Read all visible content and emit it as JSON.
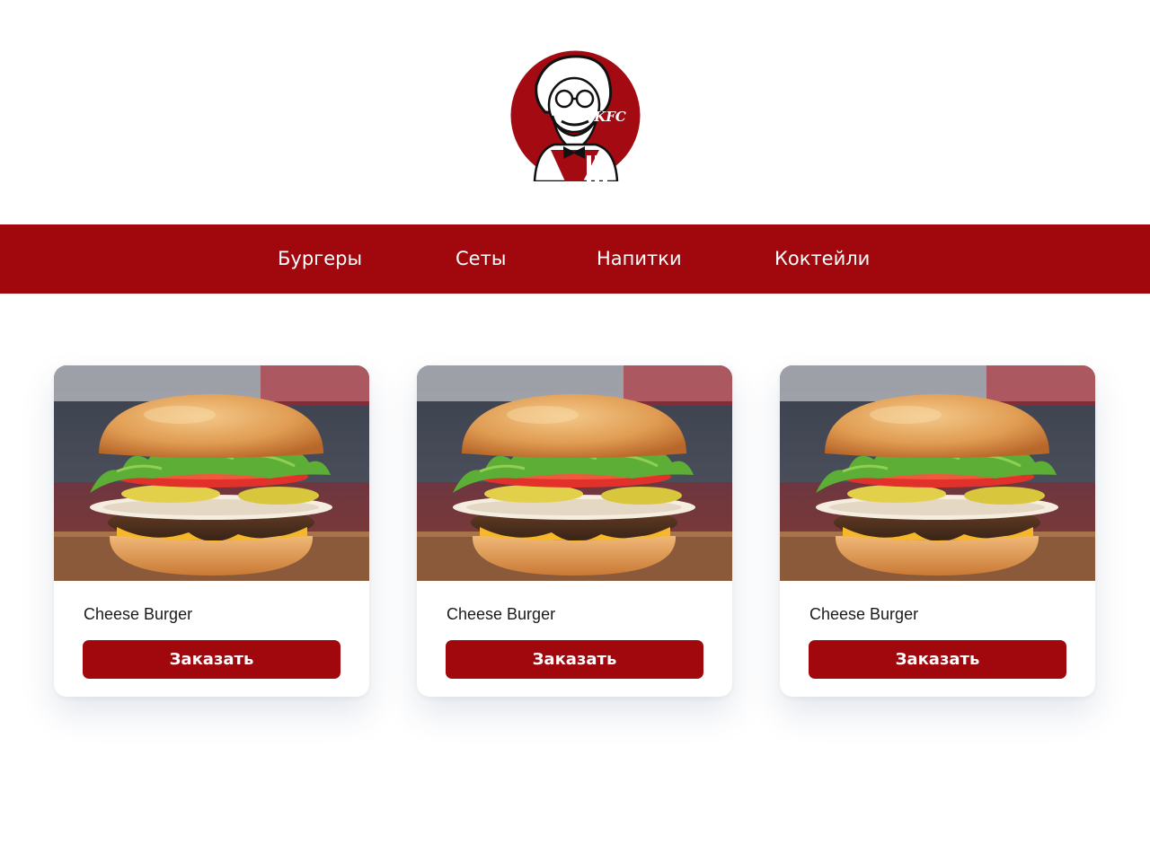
{
  "brand": {
    "logo_text": "KFC",
    "primary_color": "#a0080e"
  },
  "nav": {
    "items": [
      {
        "label": "Бургеры"
      },
      {
        "label": "Сеты"
      },
      {
        "label": "Напитки"
      },
      {
        "label": "Коктейли"
      }
    ]
  },
  "products": [
    {
      "title": "Cheese Burger",
      "button_label": "Заказать",
      "image": "cheese-burger-photo"
    },
    {
      "title": "Cheese Burger",
      "button_label": "Заказать",
      "image": "cheese-burger-photo"
    },
    {
      "title": "Cheese Burger",
      "button_label": "Заказать",
      "image": "cheese-burger-photo"
    }
  ]
}
